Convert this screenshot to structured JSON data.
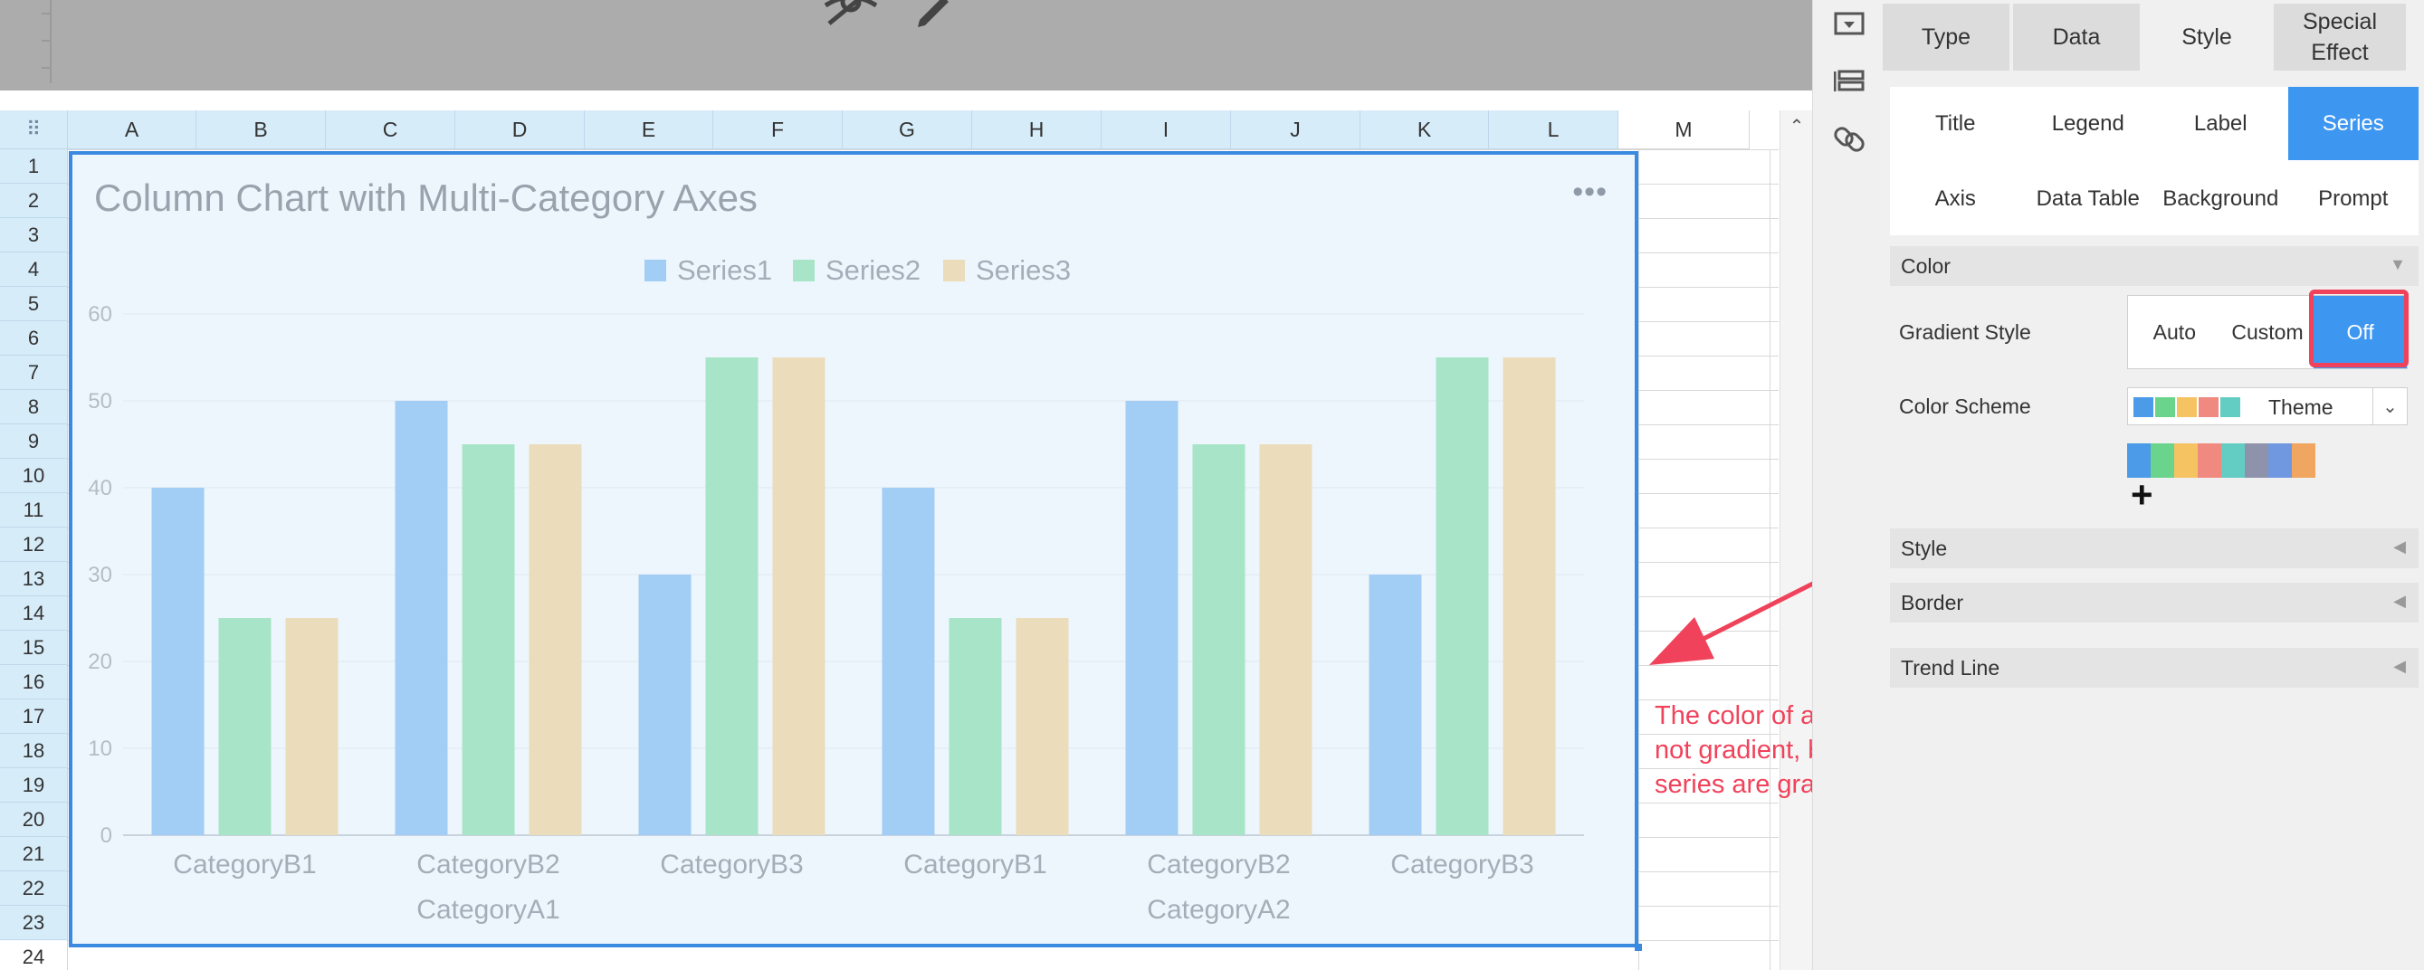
{
  "sheet": {
    "columns": [
      "A",
      "B",
      "C",
      "D",
      "E",
      "F",
      "G",
      "H",
      "I",
      "J",
      "K",
      "L",
      "M"
    ],
    "rows": [
      "1",
      "2",
      "3",
      "4",
      "5",
      "6",
      "7",
      "8",
      "9",
      "10",
      "11",
      "12",
      "13",
      "14",
      "15",
      "16",
      "17",
      "18",
      "19",
      "20",
      "21",
      "22",
      "23",
      "24"
    ],
    "select_all_icon": "⠿"
  },
  "chart": {
    "menu_label": "•••",
    "accent_border": "#3a8be0"
  },
  "chart_data": {
    "type": "bar",
    "title": "Column Chart with Multi-Category Axes",
    "categories": [
      "CategoryB1",
      "CategoryB2",
      "CategoryB3",
      "CategoryB1",
      "CategoryB2",
      "CategoryB3"
    ],
    "group_categories": [
      {
        "label": "CategoryA1",
        "span": 3
      },
      {
        "label": "CategoryA2",
        "span": 3
      }
    ],
    "series": [
      {
        "name": "Series1",
        "color": "#a2cdf4",
        "values": [
          40,
          50,
          30,
          40,
          50,
          30
        ]
      },
      {
        "name": "Series2",
        "color": "#a8e4c7",
        "values": [
          25,
          45,
          55,
          25,
          45,
          55
        ]
      },
      {
        "name": "Series3",
        "color": "#ebdcbc",
        "values": [
          25,
          45,
          55,
          25,
          45,
          55
        ]
      }
    ],
    "ylim": [
      0,
      60
    ],
    "yticks": [
      0,
      10,
      20,
      30,
      40,
      50,
      60
    ],
    "legend_position": "top-center",
    "grid": true
  },
  "panel": {
    "main_tabs": [
      "Type",
      "Data",
      "Style",
      "Special Effect"
    ],
    "active_main_tab": "Style",
    "sub_tabs": [
      "Title",
      "Legend",
      "Label",
      "Series",
      "Axis",
      "Data Table",
      "Background",
      "Prompt"
    ],
    "active_sub_tab": "Series",
    "color_section": "Color",
    "gradient_label": "Gradient Style",
    "gradient_options": [
      "Auto",
      "Custom",
      "Off"
    ],
    "gradient_selected": "Off",
    "scheme_label": "Color Scheme",
    "scheme_value": "Theme",
    "palette": [
      "#4b9be8",
      "#6bd48c",
      "#f5c362",
      "#f08a80",
      "#63cdc4",
      "#8e93ab",
      "#6f98e0",
      "#f0a560"
    ],
    "add_label": "+",
    "sections": [
      "Style",
      "Border",
      "Trend Line"
    ]
  },
  "annotation": {
    "text": "The color of a single column is not gradient, but the colors for all series are gradient.",
    "color": "#f0425a"
  },
  "icons": {
    "toolbar": [
      "chart-frame-icon",
      "layout-icon",
      "link-icon"
    ],
    "top": [
      "hide-icon",
      "edit-icon"
    ]
  }
}
